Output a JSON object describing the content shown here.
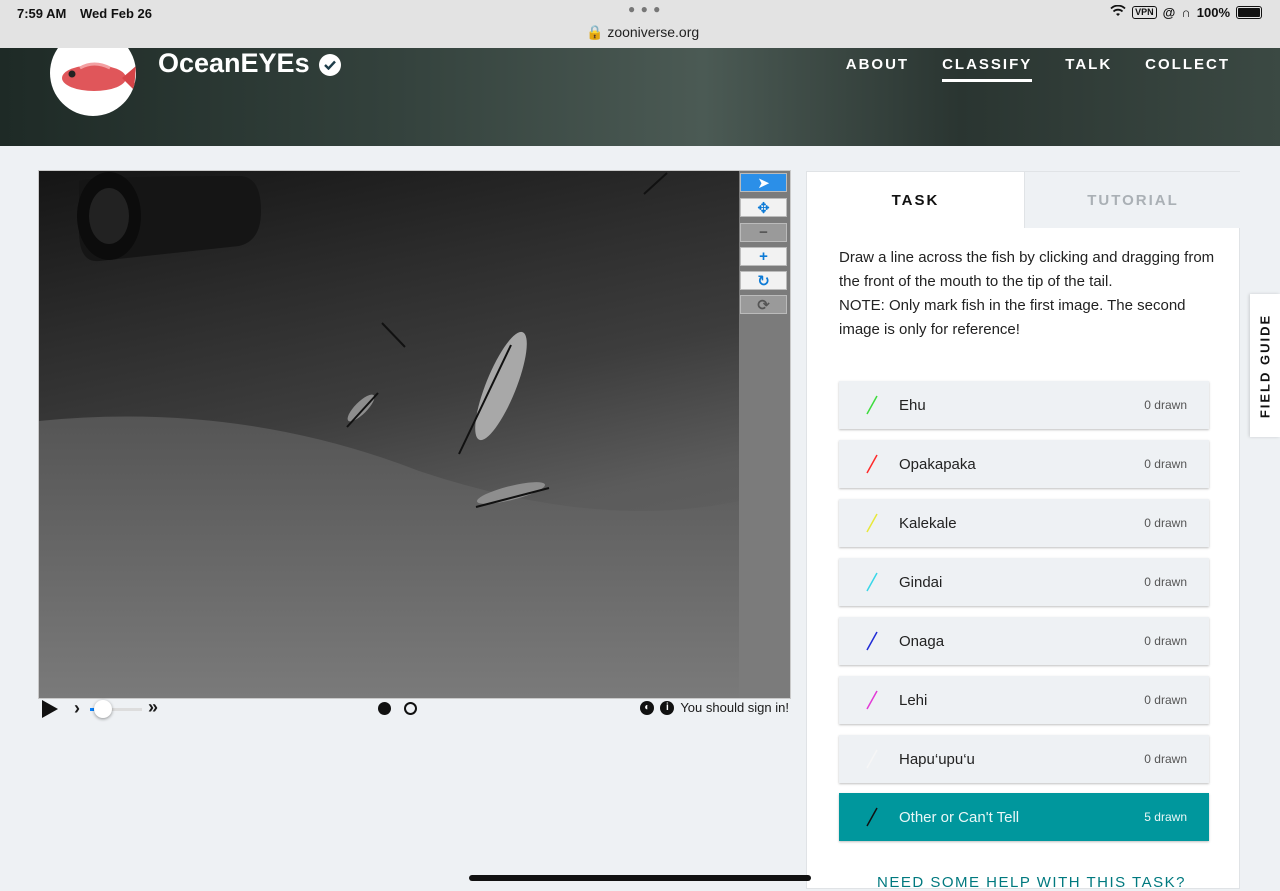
{
  "status_bar": {
    "time": "7:59 AM",
    "date": "Wed Feb 26",
    "url": "zooniverse.org",
    "vpn": "VPN",
    "battery": "100%"
  },
  "header": {
    "project_name": "OceanEYEs",
    "nav": [
      "ABOUT",
      "CLASSIFY",
      "TALK",
      "COLLECT"
    ],
    "active_nav": "CLASSIFY"
  },
  "viewer": {
    "tools": [
      "pointer-icon",
      "move-icon",
      "zoom-out-icon",
      "zoom-in-icon",
      "rotate-icon",
      "reset-icon"
    ],
    "sign_in_message": "You should sign in!"
  },
  "task_panel": {
    "tabs": [
      "TASK",
      "TUTORIAL"
    ],
    "instructions_line1": "Draw a line across the fish by clicking and dragging from the front of the mouth to the tip of the tail.",
    "instructions_line2": "NOTE: Only mark fish in the first image. The second image is only for reference!",
    "options": [
      {
        "label": "Ehu",
        "count": "0 drawn",
        "color": "#3ddc3d"
      },
      {
        "label": "Opakapaka",
        "count": "0 drawn",
        "color": "#ff2a2a"
      },
      {
        "label": "Kalekale",
        "count": "0 drawn",
        "color": "#e8e83a"
      },
      {
        "label": "Gindai",
        "count": "0 drawn",
        "color": "#38d6e8"
      },
      {
        "label": "Onaga",
        "count": "0 drawn",
        "color": "#1f2bd6"
      },
      {
        "label": "Lehi",
        "count": "0 drawn",
        "color": "#e23ad6"
      },
      {
        "label": "Hapu‘upu‘u",
        "count": "0 drawn",
        "color": "#f6f6f6"
      },
      {
        "label": "Other or Can't Tell",
        "count": "5 drawn",
        "color": "#111111"
      }
    ],
    "help_link": "NEED SOME HELP WITH THIS TASK?"
  },
  "field_guide": "FIELD GUIDE"
}
